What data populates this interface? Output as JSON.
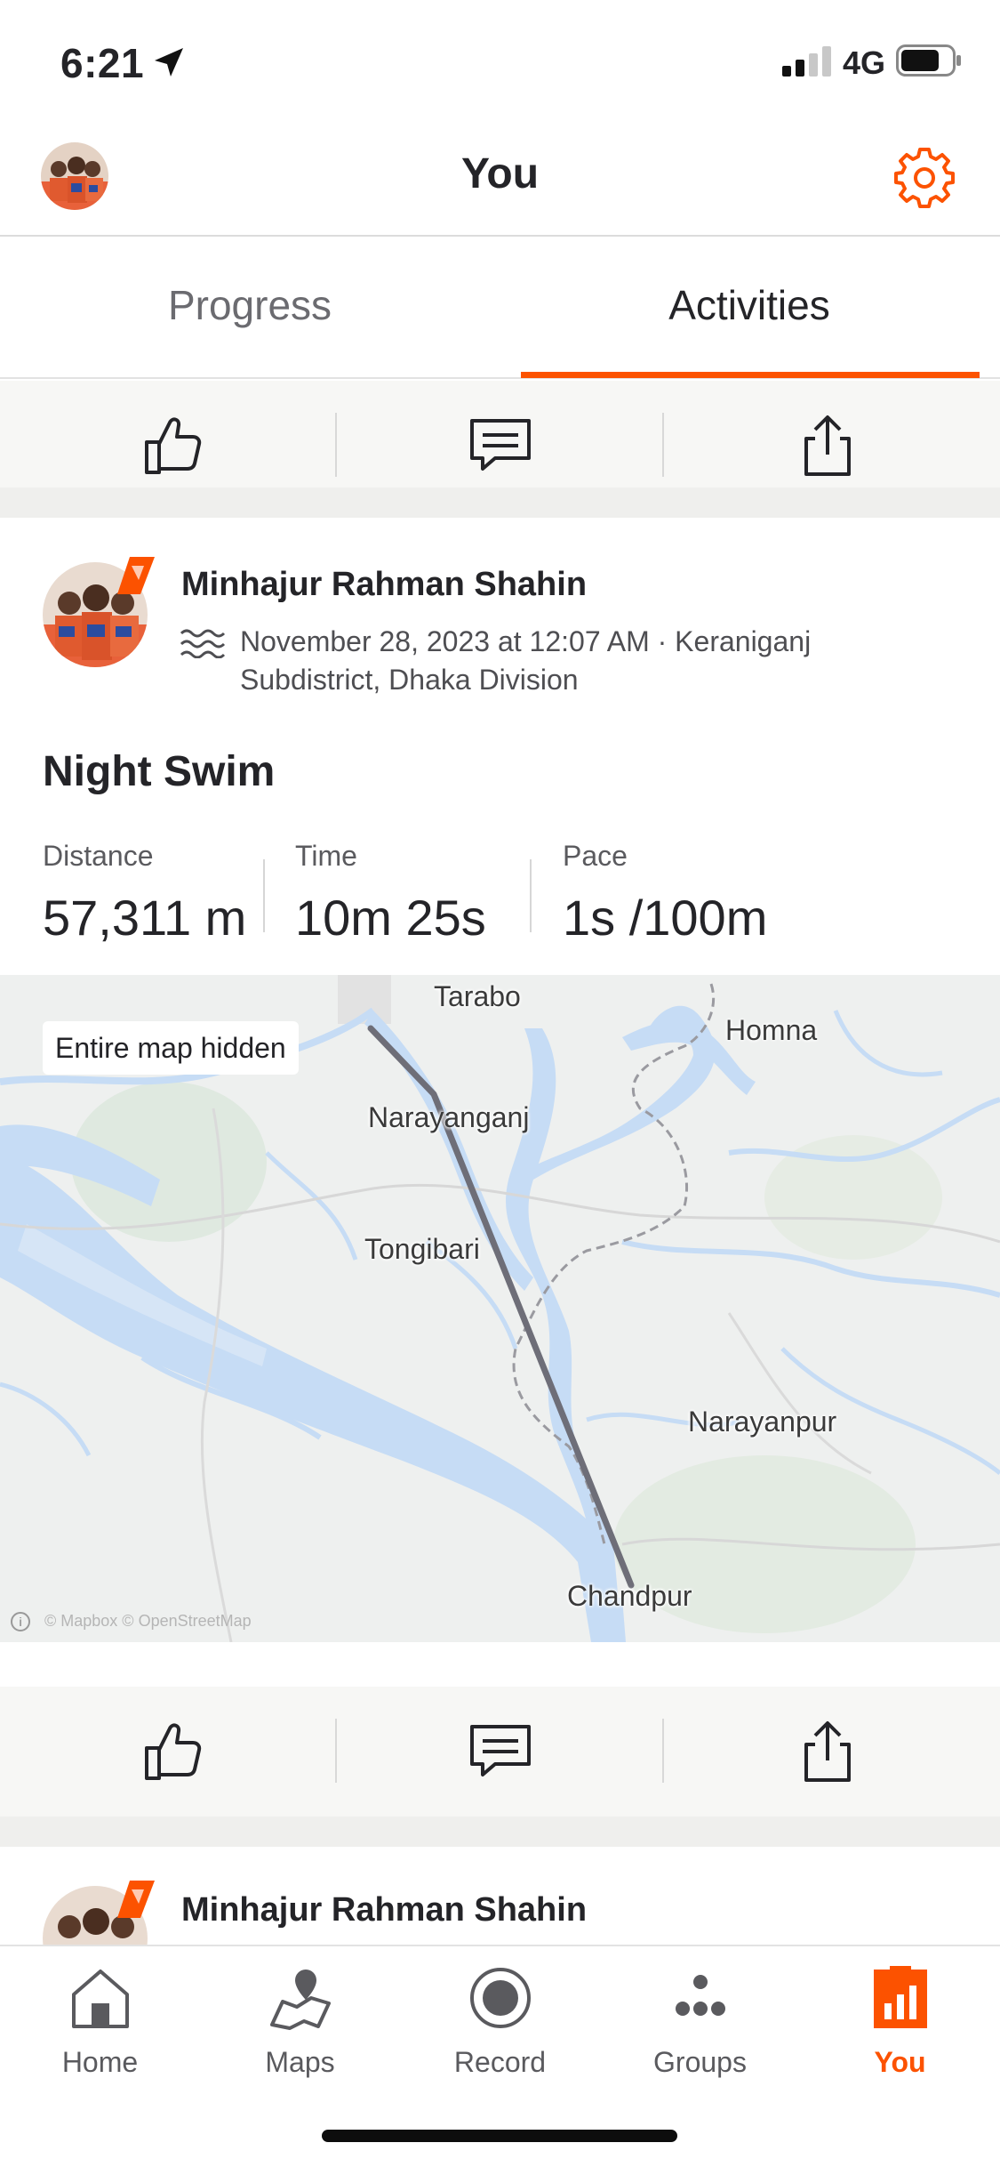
{
  "status_bar": {
    "time": "6:21",
    "network": "4G"
  },
  "header": {
    "title": "You"
  },
  "tabs": [
    {
      "label": "Progress",
      "active": false
    },
    {
      "label": "Activities",
      "active": true
    }
  ],
  "activity": {
    "athlete": "Minhajur Rahman Shahin",
    "meta": "November 28, 2023 at 12:07 AM · Keraniganj Subdistrict, Dhaka Division",
    "title": "Night Swim",
    "stats": [
      {
        "label": "Distance",
        "value": "57,311 m"
      },
      {
        "label": "Time",
        "value": "10m 25s"
      },
      {
        "label": "Pace",
        "value": "1s /100m"
      }
    ],
    "map": {
      "badge": "Entire map hidden",
      "places": [
        "Tarabo",
        "Homna",
        "Narayanganj",
        "Tongibari",
        "Narayanpur",
        "Chandpur"
      ],
      "attribution": "© Mapbox © OpenStreetMap"
    }
  },
  "next_activity": {
    "athlete": "Minhajur Rahman Shahin"
  },
  "bottom_nav": [
    {
      "label": "Home",
      "icon": "home-icon",
      "active": false
    },
    {
      "label": "Maps",
      "icon": "maps-icon",
      "active": false
    },
    {
      "label": "Record",
      "icon": "record-icon",
      "active": false
    },
    {
      "label": "Groups",
      "icon": "groups-icon",
      "active": false
    },
    {
      "label": "You",
      "icon": "you-icon",
      "active": true
    }
  ],
  "colors": {
    "accent": "#fc5200",
    "text": "#242428",
    "route": "#6e6e78",
    "water": "#c6dcf5"
  }
}
